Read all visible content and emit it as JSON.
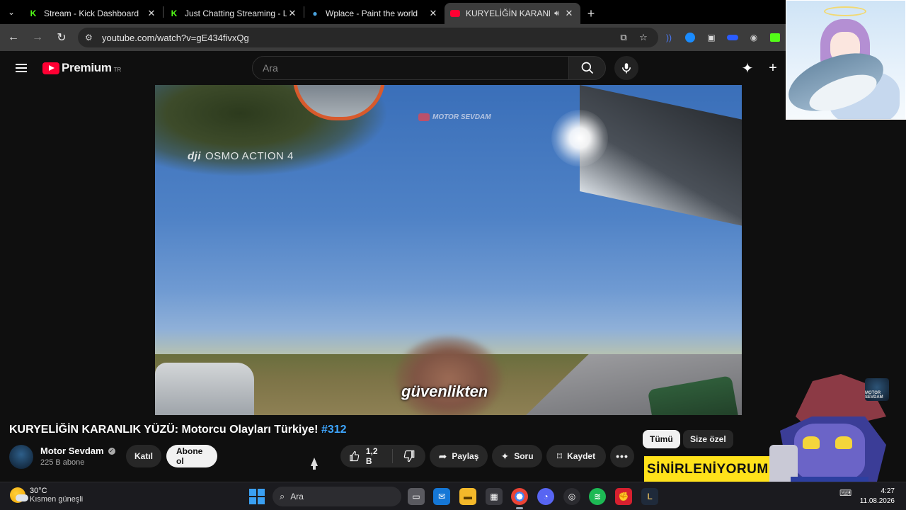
{
  "browser": {
    "tabs": [
      {
        "title": "Stream - Kick Dashboard",
        "icon": "kick-icon",
        "color": "#53fc18",
        "active": false
      },
      {
        "title": "Just Chatting Streaming - Live S",
        "icon": "kick-icon",
        "color": "#53fc18",
        "active": false
      },
      {
        "title": "Wplace - Paint the world",
        "icon": "globe-icon",
        "color": "#4aa3df",
        "active": false
      },
      {
        "title": "KURYELİĞİN KARANLIK YÜZ",
        "icon": "youtube-icon",
        "color": "#ff0033",
        "active": true
      }
    ],
    "url": "youtube.com/watch?v=gE434fivxQg"
  },
  "youtube": {
    "logo_text": "Premium",
    "country_code": "TR",
    "search_placeholder": "Ara"
  },
  "video": {
    "camera_watermark_brand": "dji",
    "camera_watermark_model": "OSMO ACTION 4",
    "channel_watermark": "MOTOR SEVDAM",
    "subtitle": "güvenlikten",
    "title": "KURYELİĞİN KARANLIK YÜZÜ: Motorcu Olayları Türkiye!",
    "hashtag": "#312"
  },
  "channel": {
    "name": "Motor Sevdam",
    "subscribers": "225 B abone",
    "join_label": "Katıl",
    "subscribe_label": "Abone ol"
  },
  "actions": {
    "likes": "1,2 B",
    "share_label": "Paylaş",
    "ask_label": "Soru",
    "save_label": "Kaydet"
  },
  "recommendations": {
    "chips": [
      "Tümü",
      "Size özel"
    ],
    "thumb_text": "SİNİRLENİYORUM B..."
  },
  "overlay": {
    "logo_text": "MOTOR SEVDAM"
  },
  "taskbar": {
    "temperature": "30°C",
    "weather": "Kısmen güneşli",
    "search_label": "Ara",
    "time": "4:27",
    "date": "11.08.2026"
  }
}
